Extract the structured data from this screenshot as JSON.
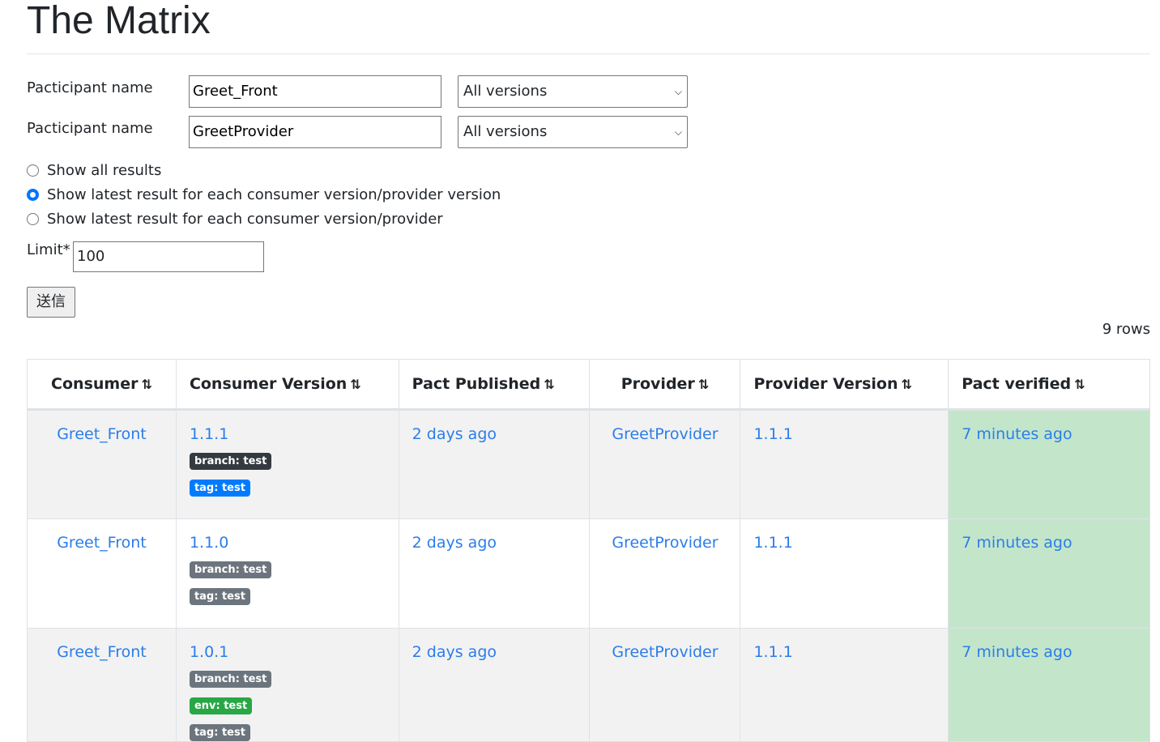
{
  "title": "The Matrix",
  "form": {
    "participants": [
      {
        "label": "Pacticipant name",
        "value": "Greet_Front",
        "version": "All versions"
      },
      {
        "label": "Pacticipant name",
        "value": "GreetProvider",
        "version": "All versions"
      }
    ],
    "radios": [
      {
        "label": "Show all results",
        "checked": false
      },
      {
        "label": "Show latest result for each consumer version/provider version",
        "checked": true
      },
      {
        "label": "Show latest result for each consumer version/provider",
        "checked": false
      }
    ],
    "limit_label": "Limit*",
    "limit_value": "100",
    "submit": "送信"
  },
  "row_count": "9 rows",
  "columns": [
    "Consumer",
    "Consumer Version",
    "Pact Published",
    "Provider",
    "Provider Version",
    "Pact verified"
  ],
  "sort_icon": "⇅",
  "rows": [
    {
      "consumer": "Greet_Front",
      "version": "1.1.1",
      "badges": [
        {
          "text": "branch: test",
          "color": "#343a40"
        },
        {
          "text": "tag: test",
          "color": "#007bff"
        }
      ],
      "published": "2 days ago",
      "provider": "GreetProvider",
      "provider_version": "1.1.1",
      "verified": "7 minutes ago"
    },
    {
      "consumer": "Greet_Front",
      "version": "1.1.0",
      "badges": [
        {
          "text": "branch: test",
          "color": "#6c757d"
        },
        {
          "text": "tag: test",
          "color": "#6c757d"
        }
      ],
      "published": "2 days ago",
      "provider": "GreetProvider",
      "provider_version": "1.1.1",
      "verified": "7 minutes ago"
    },
    {
      "consumer": "Greet_Front",
      "version": "1.0.1",
      "badges": [
        {
          "text": "branch: test",
          "color": "#6c757d"
        },
        {
          "text": "env: test",
          "color": "#28a745"
        },
        {
          "text": "tag: test",
          "color": "#6c757d"
        }
      ],
      "published": "2 days ago",
      "provider": "GreetProvider",
      "provider_version": "1.1.1",
      "verified": "7 minutes ago"
    }
  ]
}
